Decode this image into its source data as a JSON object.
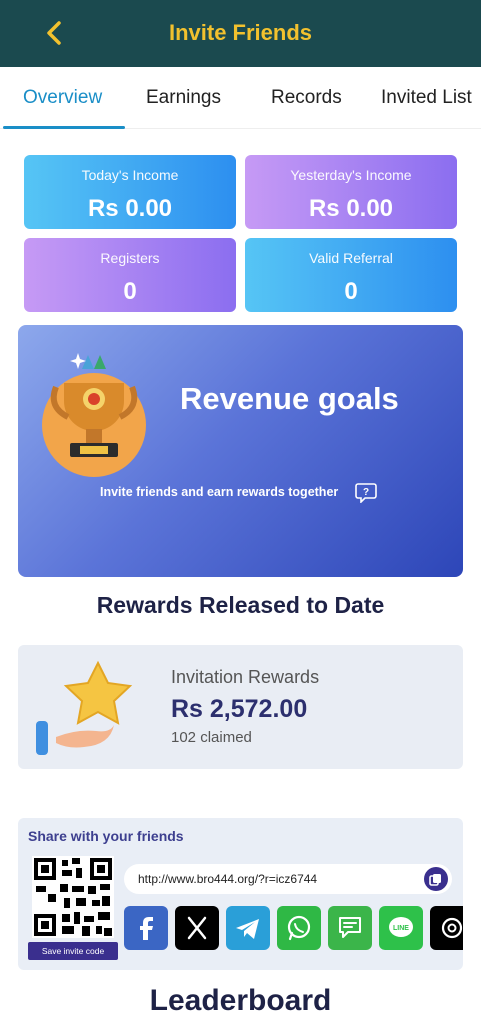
{
  "header": {
    "title": "Invite Friends",
    "back_icon": "chevron-left-icon"
  },
  "tabs": [
    {
      "label": "Overview",
      "active": true
    },
    {
      "label": "Earnings",
      "active": false
    },
    {
      "label": "Records",
      "active": false
    },
    {
      "label": "Invited List",
      "active": false
    }
  ],
  "stats": {
    "today_income": {
      "label": "Today's Income",
      "value": "Rs 0.00"
    },
    "yesterday_income": {
      "label": "Yesterday's Income",
      "value": "Rs 0.00"
    },
    "registers": {
      "label": "Registers",
      "value": "0"
    },
    "valid_referral": {
      "label": "Valid Referral",
      "value": "0"
    }
  },
  "goals": {
    "title": "Revenue goals",
    "subtitle": "Invite friends and earn rewards together",
    "help_icon": "question-bubble-icon"
  },
  "rewards_section_title": "Rewards Released to Date",
  "invitation_rewards": {
    "label": "Invitation Rewards",
    "value": "Rs 2,572.00",
    "claimed": "102 claimed"
  },
  "share": {
    "title": "Share with your friends",
    "save_label": "Save invite code",
    "link": "http://www.bro444.org/?r=icz6744",
    "copy_icon": "copy-icon",
    "socials": [
      "facebook-icon",
      "x-icon",
      "telegram-icon",
      "whatsapp-icon",
      "message-icon",
      "line-icon",
      "threads-icon"
    ]
  },
  "leaderboard_title": "Leaderboard",
  "colors": {
    "header_bg": "#1b4a4f",
    "header_title": "#f2c12e",
    "tab_active": "#1a8ec7",
    "accent_dark": "#3a2f8e"
  }
}
